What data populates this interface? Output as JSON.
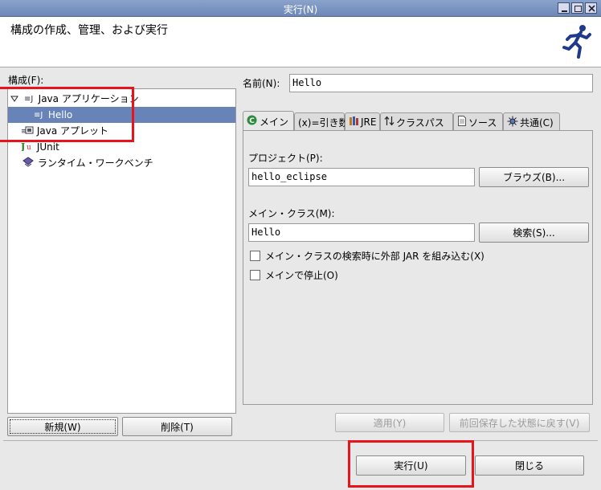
{
  "window": {
    "title": "実行(N)"
  },
  "header": {
    "heading": "構成の作成、管理、および実行"
  },
  "left": {
    "config_label": "構成(F):",
    "tree": [
      {
        "label": "Java アプリケーション"
      },
      {
        "label": "Hello"
      },
      {
        "label": "Java アプレット"
      },
      {
        "label": "JUnit"
      },
      {
        "label": "ランタイム・ワークベンチ"
      }
    ],
    "new_button": "新規(W)",
    "delete_button": "削除(T)"
  },
  "right": {
    "name_label": "名前(N):",
    "name_value": "Hello",
    "tabs": [
      {
        "label": "メイン"
      },
      {
        "label": "(x)=引き数"
      },
      {
        "label": "JRE"
      },
      {
        "label": "クラスパス"
      },
      {
        "label": "ソース"
      },
      {
        "label": "共通(C)"
      }
    ],
    "project_label": "プロジェクト(P):",
    "project_value": "hello_eclipse",
    "browse_button": "ブラウズ(B)...",
    "main_class_label": "メイン・クラス(M):",
    "main_class_value": "Hello",
    "search_button": "検索(S)...",
    "include_jar_checkbox": "メイン・クラスの検索時に外部 JAR を組み込む(X)",
    "stop_in_main_checkbox": "メインで停止(O)",
    "apply_button": "適用(Y)",
    "revert_button": "前回保存した状態に戻す(V)"
  },
  "footer": {
    "run_button": "実行(U)",
    "close_button": "閉じる"
  },
  "colors": {
    "titlebar": "#7b94c2",
    "selection": "#6883b8",
    "highlight_box": "#e8141b"
  }
}
